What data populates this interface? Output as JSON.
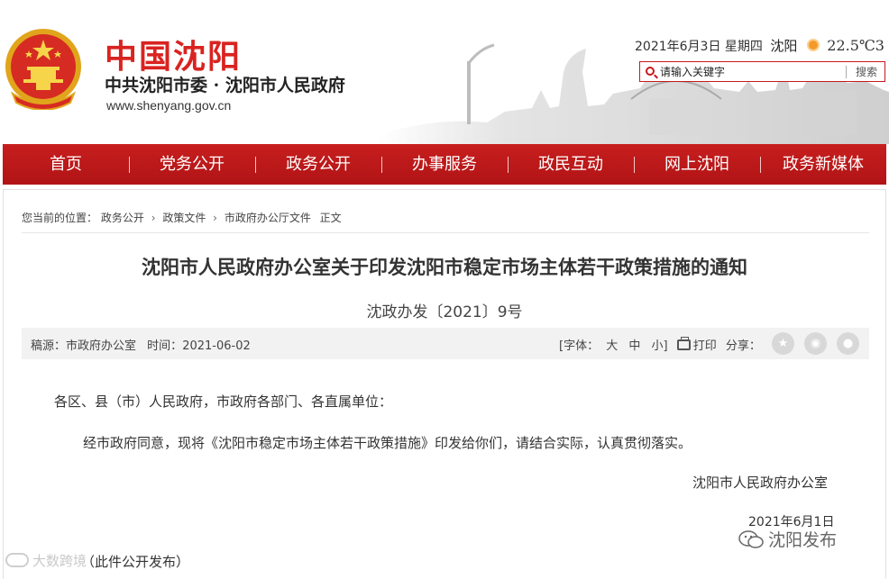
{
  "header": {
    "brand_title": "中国沈阳",
    "brand_subtitle": "中共沈阳市委 · 沈阳市人民政府",
    "brand_url": "www.shenyang.gov.cn",
    "date": "2021年6月3日 星期四",
    "city": "沈阳",
    "temperature": "22.5℃3",
    "search_placeholder": "请输入关键字",
    "search_button": "搜索"
  },
  "nav": {
    "items": [
      {
        "label": "首页"
      },
      {
        "label": "党务公开"
      },
      {
        "label": "政务公开"
      },
      {
        "label": "办事服务"
      },
      {
        "label": "政民互动"
      },
      {
        "label": "网上沈阳"
      },
      {
        "label": "政务新媒体"
      }
    ]
  },
  "breadcrumb": {
    "prefix": "您当前的位置：",
    "items": [
      "政务公开",
      "政策文件",
      "市政府办公厅文件"
    ],
    "current": "正文",
    "separator": "›"
  },
  "article": {
    "title": "沈阳市人民政府办公室关于印发沈阳市稳定市场主体若干政策措施的通知",
    "doc_number": "沈政办发〔2021〕9号",
    "meta": {
      "source_label": "稿源：",
      "source": "市政府办公室",
      "time_label": "时间：",
      "time": "2021-06-02",
      "font_label": "[字体：",
      "font_large": "大",
      "font_medium": "中",
      "font_small": "小",
      "font_close": "]",
      "print_label": "打印",
      "share_label": "分享："
    },
    "salutation": "各区、县（市）人民政府，市政府各部门、各直属单位：",
    "body": "经市政府同意，现将《沈阳市稳定市场主体若干政策措施》印发给你们，请结合实际，认真贯彻落实。",
    "signature": "沈阳市人民政府办公室",
    "sign_date": "2021年6月1日",
    "footer_note": "（此件公开发布）"
  },
  "watermarks": {
    "left": "大数跨境",
    "right": "沈阳发布"
  },
  "colors": {
    "brand_red": "#d92320",
    "nav_red": "#c71e1e",
    "meta_bg": "#f2f2f2"
  },
  "icons": {
    "share_1": "star-icon",
    "share_2": "weibo-icon",
    "share_3": "wechat-icon"
  }
}
